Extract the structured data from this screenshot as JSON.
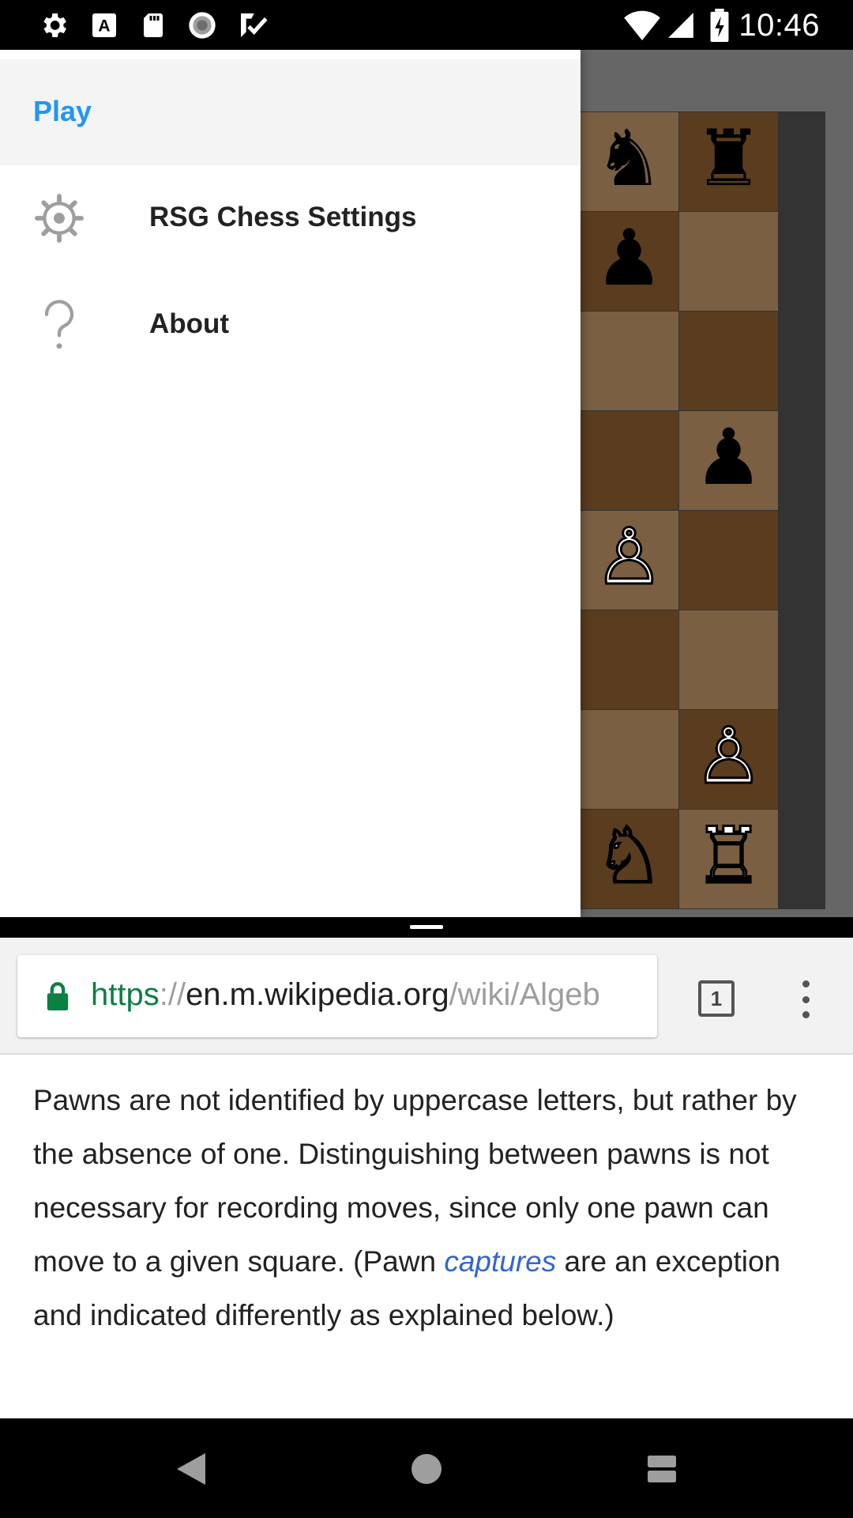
{
  "status_bar": {
    "time": "10:46",
    "left_icons": [
      "gear-icon",
      "font-a-icon",
      "sd-card-icon",
      "loading-icon",
      "check-badge-icon"
    ],
    "right_icons": [
      "wifi-icon",
      "cell-signal-icon",
      "battery-charging-icon"
    ]
  },
  "drawer": {
    "header_label": "Play",
    "items": [
      {
        "label": "RSG Chess Settings",
        "icon": "settings-icon"
      },
      {
        "label": "About",
        "icon": "help-icon"
      }
    ]
  },
  "board": {
    "squares": [
      [
        "dark",
        "♝",
        "black"
      ],
      [
        "light",
        "♞",
        "black"
      ],
      [
        "dark",
        "♜",
        "black"
      ],
      [
        "light",
        "♟",
        "black"
      ],
      [
        "dark",
        "♟",
        "black"
      ],
      [
        "light",
        "",
        ""
      ],
      [
        "dark",
        "",
        ""
      ],
      [
        "light",
        "",
        ""
      ],
      [
        "dark",
        "",
        ""
      ],
      [
        "light",
        "",
        ""
      ],
      [
        "dark",
        "",
        ""
      ],
      [
        "light",
        "♟",
        "black"
      ],
      [
        "dark",
        "",
        ""
      ],
      [
        "light",
        "♙",
        "white"
      ],
      [
        "dark",
        "",
        ""
      ],
      [
        "light",
        "",
        ""
      ],
      [
        "dark",
        "",
        ""
      ],
      [
        "light",
        "",
        ""
      ],
      [
        "dark",
        "♙",
        "white"
      ],
      [
        "light",
        "",
        ""
      ],
      [
        "dark",
        "♙",
        "white"
      ],
      [
        "light",
        "♗",
        "white"
      ],
      [
        "dark",
        "♘",
        "white"
      ],
      [
        "light",
        "♖",
        "white"
      ]
    ]
  },
  "browser": {
    "url": {
      "scheme": "https",
      "separator": "://",
      "host": "en.m.wikipedia.org",
      "path": "/wiki/Algeb"
    },
    "tab_count": "1",
    "article": {
      "part1": "Pawns are not identified by uppercase letters, but rather by the absence of one. Distinguishing between pawns is not necessary for recording moves, since only one pawn can move to a given square. (Pawn ",
      "link": "captures",
      "part2": " are an exception and indicated differently as explained below.)"
    }
  },
  "nav_bar": {
    "buttons": [
      "back-icon",
      "home-icon",
      "recents-icon"
    ]
  },
  "colors": {
    "accent": "#2196f3",
    "link": "#3366cc",
    "url_scheme": "#0b8043",
    "board_dark": "#5a3c1e",
    "board_light": "#7a5f42"
  }
}
